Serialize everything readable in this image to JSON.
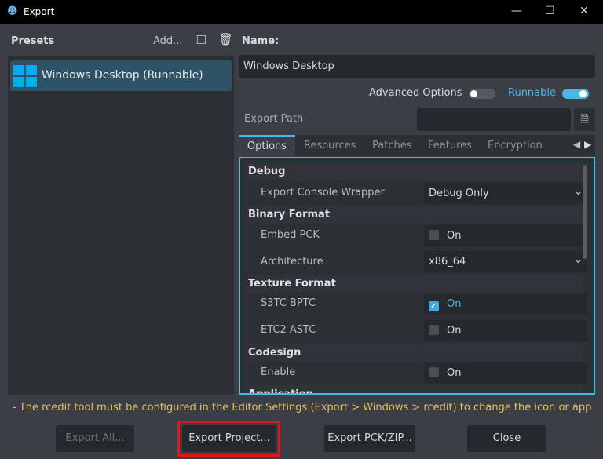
{
  "window": {
    "title": "Export",
    "minimize": "—",
    "maximize": "☐",
    "close": "✕"
  },
  "presets": {
    "label": "Presets",
    "add": "Add...",
    "items": [
      {
        "label": "Windows Desktop (Runnable)",
        "selected": true
      }
    ]
  },
  "name": {
    "label": "Name:",
    "value": "Windows Desktop"
  },
  "advanced_options": {
    "label": "Advanced Options",
    "on": false
  },
  "runnable": {
    "label": "Runnable",
    "on": true
  },
  "export_path": {
    "label": "Export Path",
    "value": ""
  },
  "tabs": [
    {
      "label": "Options",
      "active": true
    },
    {
      "label": "Resources"
    },
    {
      "label": "Patches"
    },
    {
      "label": "Features"
    },
    {
      "label": "Encryption"
    }
  ],
  "options": {
    "debug": "Debug",
    "export_console_wrapper": {
      "label": "Export Console Wrapper",
      "value": "Debug Only"
    },
    "binary_format": "Binary Format",
    "embed_pck": {
      "label": "Embed PCK",
      "value": "On",
      "checked": false
    },
    "architecture": {
      "label": "Architecture",
      "value": "x86_64"
    },
    "texture_format": "Texture Format",
    "s3tc_bptc": {
      "label": "S3TC BPTC",
      "value": "On",
      "checked": true
    },
    "etc2_astc": {
      "label": "ETC2 ASTC",
      "value": "On",
      "checked": false
    },
    "codesign": "Codesign",
    "enable": {
      "label": "Enable",
      "value": "On",
      "checked": false
    },
    "application": "Application"
  },
  "warning": "- The rcedit tool must be configured in the Editor Settings (Export > Windows > rcedit) to change the icon or app ...",
  "buttons": {
    "export_all": "Export All...",
    "export_project": "Export Project...",
    "export_pck": "Export PCK/ZIP...",
    "close": "Close"
  },
  "colors": {
    "accent": "#4fb4e8",
    "warning": "#e3c15a",
    "highlight": "#e0161e"
  }
}
